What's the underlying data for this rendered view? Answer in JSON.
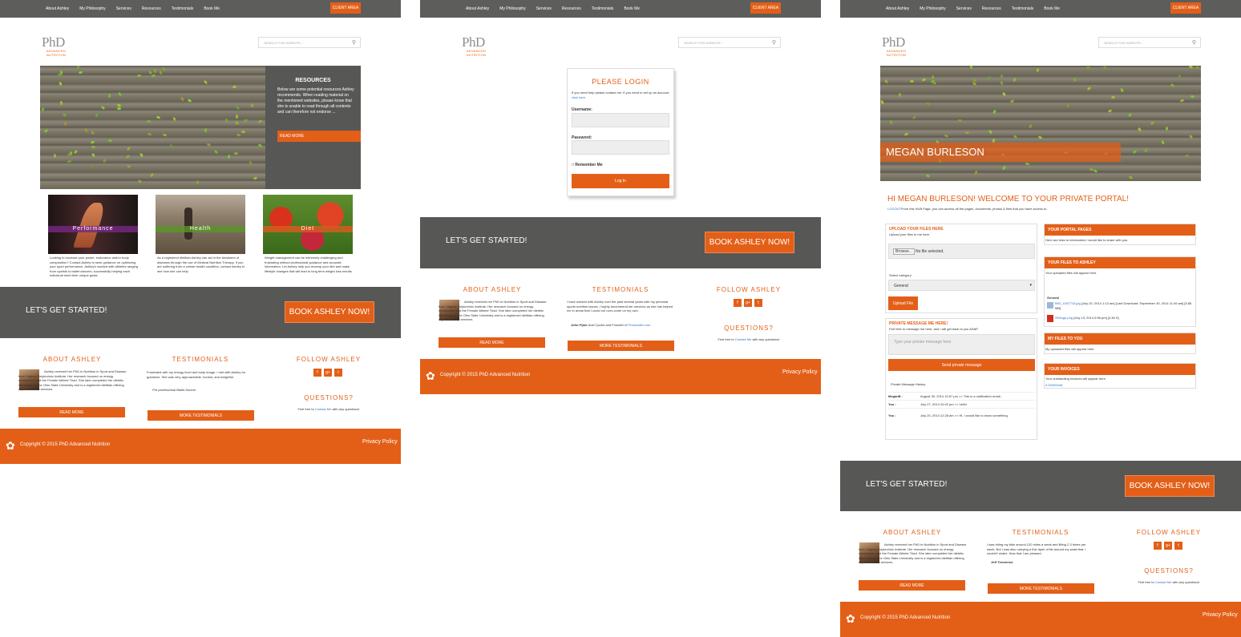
{
  "colors": {
    "accent": "#e35f18",
    "dark": "#575755",
    "topbar": "#5d5d5b"
  },
  "nav": {
    "items": [
      "About Ashley",
      "My Philosophy",
      "Services",
      "Resources",
      "Testimonials",
      "Book Me"
    ],
    "client_area": "CLIENT AREA"
  },
  "logo": {
    "mark": "PhD",
    "sub": "ADVANCED NUTRITION"
  },
  "search": {
    "placeholder": "SEARCH THIS WEBSITE..."
  },
  "resources": {
    "title": "RESOURCES",
    "text": "Below are some potential resources Ashley recommends. When reading material on the mentioned websites, please know that she is unable to read through all contents and can therefore not endorse ...",
    "button": "READ MORE"
  },
  "services": [
    {
      "label": "Performance",
      "text": "Looking to increase your power, endurance and/or body composition? Contact Ashley to seek guidance on optimizing your sport performance. Ashley's worked with athletes ranging from cyclists to ballet dancers, successfully helping each individual meet their unique goals."
    },
    {
      "label": "Health",
      "text": "As a registered dietitian Ashley can aid in the treatment of diseases through the use of Medical Nutrition Therapy. If you are suffering from a certain health condition, contact Ashley to see how she can help."
    },
    {
      "label": "Diet",
      "text": "Weight management can be extremely challenging and frustrating without professional guidance and accurate information. Let Ashley help you revamp your diet and make lifestyle changes that will lead to long term weight loss results."
    }
  ],
  "cta": {
    "text": "LET'S GET STARTED!",
    "button": "BOOK ASHLEY NOW!"
  },
  "about": {
    "title": "ABOUT ASHLEY",
    "text": "Ashley received her PhD in Nutrition in Sport and Disease from Virginia Polytechnic Institute. Her research focused on energy metabolism and the Female Athlete Triad. She later completed her dietetic internship at The Ohio State University and is a registered dietitian offering expert nutrition services.",
    "button": "READ MORE"
  },
  "testimonials": {
    "title": "TESTIMONIALS",
    "p1_text": "Frustrated with my energy level and body image, I met with Ashley for guidance. She was very approachable, honest, and insightful.",
    "p1_author": "Pre-professional Ballet Dancer",
    "p2_text": "I have worked with Ashley over the past several years with my personal sports nutrition issues. I highly recommend her services as she has helped me in areas that I could not over-come on my own.",
    "p2_author": "John Piper",
    "p2_author_rest": " Avid Cyclist and Founder of ",
    "p2_link": "Proombike.com",
    "p3_text": "I was riding my bike around 120 miles a week and lifting 2-3 times per week. But I was also carrying a thin layer of fat around my waist that I couldn't shake. Now that I am pleased.",
    "p3_author": "Jeff Trevarrow",
    "button": "MORE TESTIMONIALS"
  },
  "follow": {
    "title": "FOLLOW ASHLEY",
    "icons": [
      "f",
      "g+",
      "t"
    ]
  },
  "questions": {
    "title": "QUESTIONS?",
    "pre": "Feel free to ",
    "link": "Contact Me",
    "post": " with any questions!"
  },
  "footer": {
    "copyright": "Copyright © 2015 PhD Advanced Nutrition",
    "privacy": "Privacy Policy"
  },
  "login": {
    "title": "PLEASE LOGIN",
    "intro": "If you need help please contact me. If you need to set up an account, ",
    "intro_link": "click here.",
    "username": "Username:",
    "password": "Password:",
    "remember": "Remember Me",
    "button": "Log In"
  },
  "portal": {
    "banner_name": "MEGAN BURLESON",
    "welcome": "HI MEGAN BURLESON! WELCOME TO YOUR PRIVATE PORTAL!",
    "logout": "LOGOUT",
    "intro": "From this HUB Page, you can access all the pages, documents, photos & files that you have access to.",
    "upload_title": "UPLOAD YOUR FILES HERE",
    "upload_sub": "Upload your files to me here.",
    "browse": "Browse...",
    "no_file": "No file selected.",
    "category_label": "Select category:",
    "category": "General",
    "upload_btn": "Upload File",
    "msg_title": "PRIVATE MESSAGE ME HERE!",
    "msg_sub": "Feel free to message me here, and I will get back to you ASAP.",
    "msg_placeholder": "Type your private message here",
    "send_btn": "Send private message",
    "history_title": "Private Message History",
    "history": [
      {
        "who": "MeganB :",
        "text": "August 30, 2014 10:57 pm >> This is a notification email.."
      },
      {
        "who": "You :",
        "text": "July 27, 2014 10:02 pm >> hello!"
      },
      {
        "who": "You :",
        "text": "July 20, 2014 12:28 am >> Hi, I would like to know something."
      }
    ],
    "pages_title": "YOUR PORTAL PAGES",
    "pages_text": "Here are links to information I would like to share with you.",
    "files_to_title": "YOUR FILES TO ASHLEY",
    "files_to_text": "Your uploaded files will appear here.",
    "files_group": "General",
    "files": [
      {
        "name": "IMG_0187715.jpg",
        "meta": " [July 20, 2014 1:13 am] [Last Download: September 30, 2014 11:49 am] [5.85 MB]"
      },
      {
        "name": "250logo.png",
        "meta": " [July 19, 2014 9:56 pm] [4.36 K]"
      }
    ],
    "my_files_title": "MY FILES TO YOU",
    "my_files_text": "My uploaded files will appear here.",
    "invoices_title": "YOUR INVOICES",
    "invoices_text": "Your outstanding invoices will appear here.",
    "invoice_id": "# 00000048"
  }
}
